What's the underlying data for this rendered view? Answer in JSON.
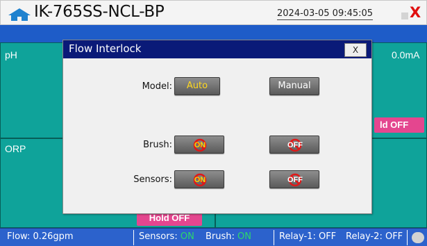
{
  "header": {
    "title": "IK-765SS-NCL-BP",
    "datetime": "2024-03-05 09:45:05",
    "close_glyph": "X",
    "home_icon": "home-icon",
    "accent": "#1e5cc8"
  },
  "panels": {
    "ph": {
      "label": "pH",
      "current": "0.0mA",
      "hold_chip": "ld OFF"
    },
    "orp": {
      "label": "ORP",
      "hold_chip": "Hold OFF"
    },
    "color": "#0fa39a"
  },
  "dialog": {
    "title": "Flow Interlock",
    "close_label": "X",
    "model": {
      "label": "Model:",
      "auto": "Auto",
      "manual": "Manual"
    },
    "brush": {
      "label": "Brush:",
      "on": "ON",
      "off": "OFF"
    },
    "sensors": {
      "label": "Sensors:",
      "on": "ON",
      "off": "OFF"
    },
    "header_color": "#0a1a78"
  },
  "status": {
    "flow": "Flow:  0.26gpm",
    "sensors_label": "Sensors:",
    "sensors_value": "ON",
    "brush_label": "Brush:",
    "brush_value": "ON",
    "relay1": "Relay-1: OFF",
    "relay2": "Relay-2: OFF",
    "on_color": "#2cd86a"
  }
}
